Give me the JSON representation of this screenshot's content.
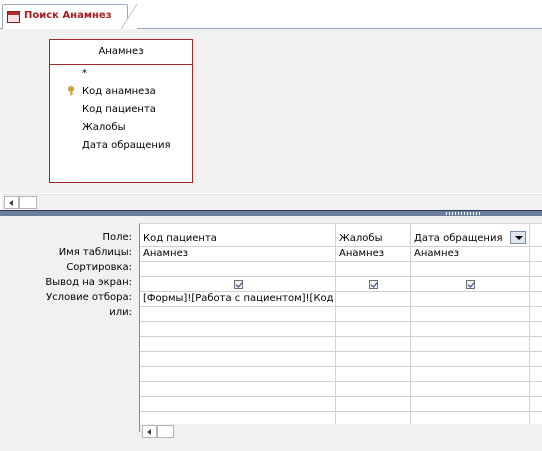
{
  "tab": {
    "title": "Поиск Анамнез",
    "icon": "query-icon"
  },
  "field_list": {
    "title": "Анамнез",
    "items": [
      {
        "label": "*",
        "key": false
      },
      {
        "label": "Код анамнеза",
        "key": true
      },
      {
        "label": "Код пациента",
        "key": false
      },
      {
        "label": "Жалобы",
        "key": false
      },
      {
        "label": "Дата обращения",
        "key": false
      }
    ]
  },
  "grid": {
    "row_labels": {
      "field": "Поле:",
      "table": "Имя таблицы:",
      "sort": "Сортировка:",
      "show": "Вывод на экран:",
      "criteria": "Условие отбора:",
      "or": "или:"
    },
    "columns": [
      {
        "field": "Код пациента",
        "table": "Анамнез",
        "sort": "",
        "show": true,
        "criteria": "[Формы]![Работа с пациентом]![Код"
      },
      {
        "field": "Жалобы",
        "table": "Анамнез",
        "sort": "",
        "show": true,
        "criteria": ""
      },
      {
        "field": "Дата обращения",
        "table": "Анамнез",
        "sort": "",
        "show": true,
        "criteria": "",
        "has_dropdown": true
      }
    ]
  }
}
